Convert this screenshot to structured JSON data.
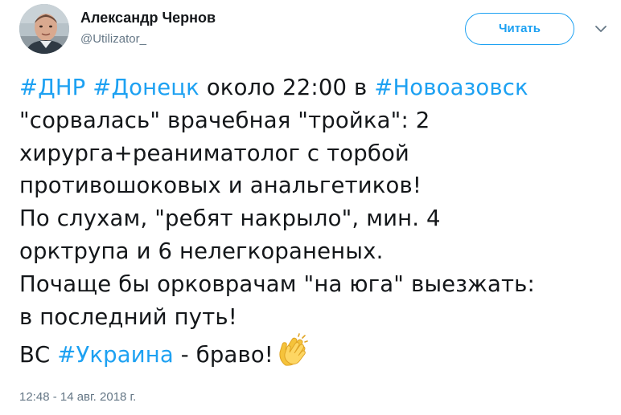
{
  "author": {
    "display_name": "Александр Чернов",
    "handle": "@Utilizator_"
  },
  "follow_button": {
    "label": "Читать"
  },
  "icons": {
    "more": "chevron-down-icon",
    "emoji": "clapping-hands-icon",
    "avatar": "user-avatar-photo"
  },
  "colors": {
    "accent": "#1da1f2",
    "text": "#14171a",
    "muted": "#657786"
  },
  "tweet": {
    "lines": [
      [
        {
          "type": "hashtag",
          "text": "#ДНР"
        },
        {
          "type": "text",
          "text": " "
        },
        {
          "type": "hashtag",
          "text": "#Донецк"
        },
        {
          "type": "text",
          "text": " около 22:00 в "
        },
        {
          "type": "hashtag",
          "text": "#Новоазовск"
        }
      ],
      [
        {
          "type": "text",
          "text": "\"сорвалась\" врачебная \"тройка\": 2"
        }
      ],
      [
        {
          "type": "text",
          "text": "хирурга+реаниматолог с торбой"
        }
      ],
      [
        {
          "type": "text",
          "text": "противошоковых и анальгетиков!"
        }
      ],
      [
        {
          "type": "text",
          "text": "По слухам, \"ребят накрыло\", мин. 4"
        }
      ],
      [
        {
          "type": "text",
          "text": "орктрупа и 6 нелегкораненых."
        }
      ],
      [
        {
          "type": "text",
          "text": "Почаще бы орковрачам \"на юга\" выезжать:"
        }
      ],
      [
        {
          "type": "text",
          "text": "в последний путь!"
        }
      ],
      [
        {
          "type": "text",
          "text": "ВС "
        },
        {
          "type": "hashtag",
          "text": "#Украина"
        },
        {
          "type": "text",
          "text": " - браво!"
        },
        {
          "type": "emoji",
          "text": "👏"
        }
      ]
    ]
  },
  "timestamp": "12:48 - 14 авг. 2018 г."
}
